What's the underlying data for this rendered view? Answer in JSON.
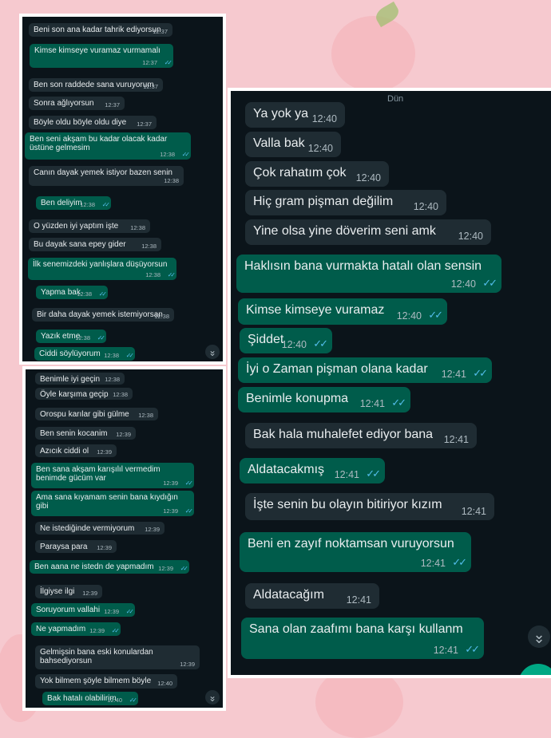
{
  "panel1": {
    "messages": [
      {
        "side": "in",
        "text": "Beni son ana kadar tahrik ediyorsun",
        "time": "12:37"
      },
      {
        "side": "out",
        "text": "Kimse kimseye vuramaz vurmamalı",
        "time": "12:37"
      },
      {
        "side": "in",
        "text": "Ben son raddede sana vuruyorum",
        "time": "12:37"
      },
      {
        "side": "in",
        "text": "Sonra ağlıyorsun",
        "time": "12:37"
      },
      {
        "side": "in",
        "text": "Böyle oldu böyle oldu diye",
        "time": "12:37"
      },
      {
        "side": "out",
        "text": "Ben seni akşam bu kadar olacak kadar",
        "text2": "üstüne gelmesim",
        "time": "12:38"
      },
      {
        "side": "in",
        "text": "Canın dayak yemek istiyor bazen senin",
        "time": "12:38"
      },
      {
        "side": "out",
        "text": "Ben deliyim",
        "time": "12:38"
      },
      {
        "side": "in",
        "text": "O yüzden iyi yaptım işte",
        "time": "12:38"
      },
      {
        "side": "in",
        "text": "Bu dayak sana epey gider",
        "time": "12:38"
      },
      {
        "side": "out",
        "text": "İlk senemizdeki yanlışlara düşüyorsun",
        "time": "12:38"
      },
      {
        "side": "out",
        "text": "Yapma bak",
        "time": "12:38"
      },
      {
        "side": "in",
        "text": "Bir daha dayak yemek istemiyorsan",
        "time": "12:38"
      },
      {
        "side": "out",
        "text": "Yazık etme",
        "time": "12:38"
      },
      {
        "side": "out",
        "text": "Ciddi söylüyorum",
        "time": "12:38"
      }
    ],
    "scroll_icon": "chevrons-down-icon"
  },
  "panel2": {
    "messages": [
      {
        "side": "in",
        "text": "Benimle iyi geçin",
        "time": "12:38"
      },
      {
        "side": "in",
        "text": "Öyle karşıma geçip",
        "time": "12:38"
      },
      {
        "side": "in",
        "text": "Orospu karılar gibi gülme",
        "time": "12:38"
      },
      {
        "side": "in",
        "text": "Ben senin kocanim",
        "time": "12:39"
      },
      {
        "side": "in",
        "text": "Azıcık ciddi ol",
        "time": "12:39"
      },
      {
        "side": "out",
        "text": "Ben sana akşam karışılıl vermedim",
        "text2": "benimde gücüm var",
        "time": "12:39"
      },
      {
        "side": "out",
        "text": "Ama sana kıyamam senin bana kıydığın",
        "text2": "gibi",
        "time": "12:39"
      },
      {
        "side": "in",
        "text": "Ne istediğinde vermiyorum",
        "time": "12:39"
      },
      {
        "side": "in",
        "text": "Paraysa para",
        "time": "12:39"
      },
      {
        "side": "out",
        "text": "Ben aana ne istedn de yapmadım",
        "time": "12:39"
      },
      {
        "side": "in",
        "text": "İlgiyse ilgi",
        "time": "12:39"
      },
      {
        "side": "out",
        "text": "Soruyorum vallahi",
        "time": "12:39"
      },
      {
        "side": "out",
        "text": "Ne yapmadım",
        "time": "12:39"
      },
      {
        "side": "in",
        "text": "Gelmişsin bana eski konulardan",
        "text2": "bahsediyorsun",
        "time": "12:39"
      },
      {
        "side": "in",
        "text": "Yok bilmem şöyle bilmem böyle",
        "time": "12:40"
      },
      {
        "side": "out",
        "text": "Bak hatalı olabilirim",
        "time": "12:40"
      }
    ],
    "scroll_icon": "chevrons-down-icon"
  },
  "panel3": {
    "day_label": "Dün",
    "messages": [
      {
        "side": "in",
        "text": "Ya yok ya",
        "time": "12:40"
      },
      {
        "side": "in",
        "text": "Valla bak",
        "time": "12:40"
      },
      {
        "side": "in",
        "text": "Çok rahatım çok",
        "time": "12:40"
      },
      {
        "side": "in",
        "text": "Hiç gram pişman değilim",
        "time": "12:40"
      },
      {
        "side": "in",
        "text": "Yine olsa yine döverim seni amk",
        "time": "12:40"
      },
      {
        "side": "out",
        "text": "Haklısın bana vurmakta hatalı olan sensin",
        "time": "12:40"
      },
      {
        "side": "out",
        "text": "Kimse kimseye vuramaz",
        "time": "12:40"
      },
      {
        "side": "out",
        "text": "Şiddet",
        "time": "12:40"
      },
      {
        "side": "out",
        "text": "İyi o Zaman pişman olana kadar",
        "time": "12:41"
      },
      {
        "side": "out",
        "text": "Benimle konupma",
        "time": "12:41"
      },
      {
        "side": "in",
        "text": "Bak hala muhalefet ediyor bana",
        "time": "12:41"
      },
      {
        "side": "out",
        "text": "Aldatacakmış",
        "time": "12:41"
      },
      {
        "side": "in",
        "text": "İşte senin bu olayın bitiriyor kızım",
        "time": "12:41"
      },
      {
        "side": "out",
        "text": "Beni en zayıf noktamsan vuruyorsun",
        "time": "12:41"
      },
      {
        "side": "in",
        "text": "Aldatacağım",
        "time": "12:41"
      },
      {
        "side": "out",
        "text": "Sana olan zaafımı bana karşı kullanm",
        "time": "12:41"
      }
    ],
    "scroll_icon": "chevrons-down-icon",
    "fab_icon": "new-chat-icon"
  },
  "colors": {
    "background": "#f6c9cf",
    "chat_bg": "#0b141a",
    "incoming": "#1f2c33",
    "outgoing": "#005c4b",
    "read_tick": "#53bdeb"
  },
  "tick_glyph": "✓✓",
  "scroll_glyph": "⌄"
}
